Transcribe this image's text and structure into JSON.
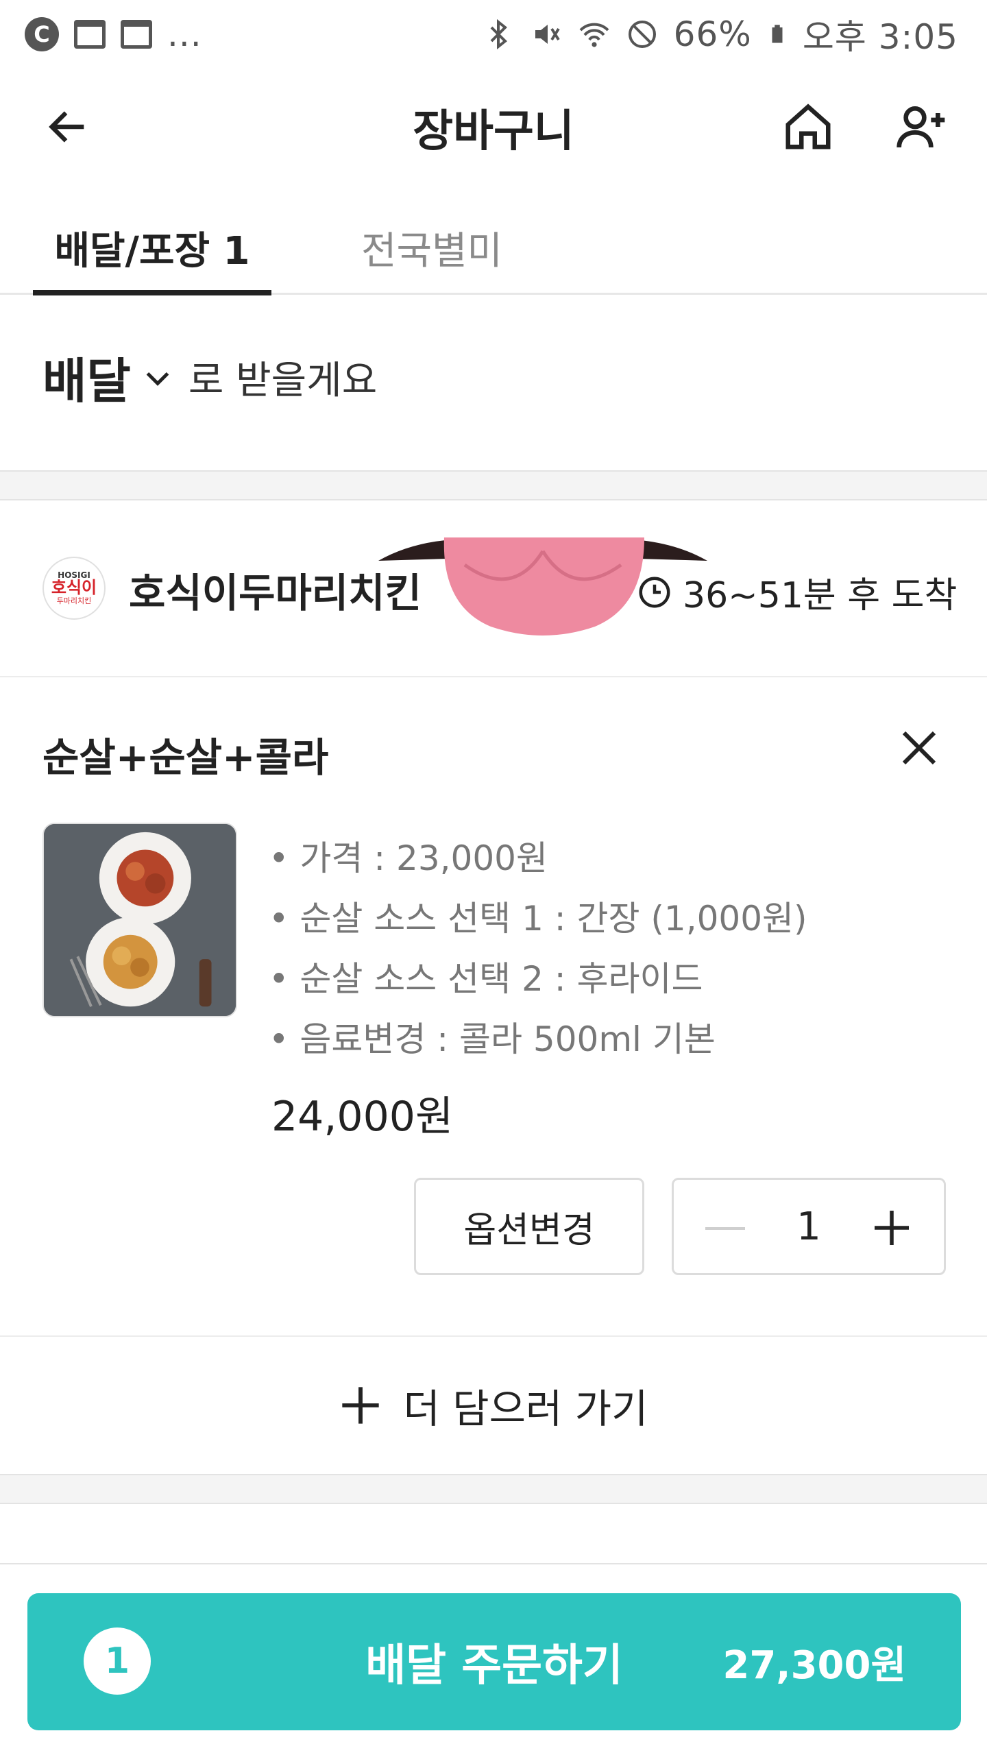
{
  "status_bar": {
    "dots": "...",
    "battery": "66%",
    "time": "오후 3:05"
  },
  "header": {
    "title": "장바구니"
  },
  "tabs": [
    {
      "label": "배달/포장 1",
      "active": true
    },
    {
      "label": "전국별미",
      "active": false
    }
  ],
  "delivery_mode": {
    "value": "배달",
    "suffix": "로 받을게요"
  },
  "store": {
    "logo": {
      "line1": "HOSIGI",
      "line2": "호식이",
      "line3": "두마리치킨"
    },
    "name": "호식이두마리치킨",
    "eta": "36~51분 후 도착"
  },
  "item": {
    "name": "순살+순살+콜라",
    "options": [
      "가격 : 23,000원",
      "순살 소스 선택 1 : 간장 (1,000원)",
      "순살 소스 선택 2 : 후라이드",
      "음료변경 : 콜라 500ml 기본"
    ],
    "total": "24,000원",
    "option_button": "옵션변경",
    "quantity": "1"
  },
  "add_more": {
    "label": "더 담으러 가기"
  },
  "order": {
    "count": "1",
    "label": "배달 주문하기",
    "price": "27,300원"
  },
  "colors": {
    "accent": "#2ec4bf",
    "brand_red": "#d6232a",
    "sticker_pink": "#ee8aa0"
  }
}
